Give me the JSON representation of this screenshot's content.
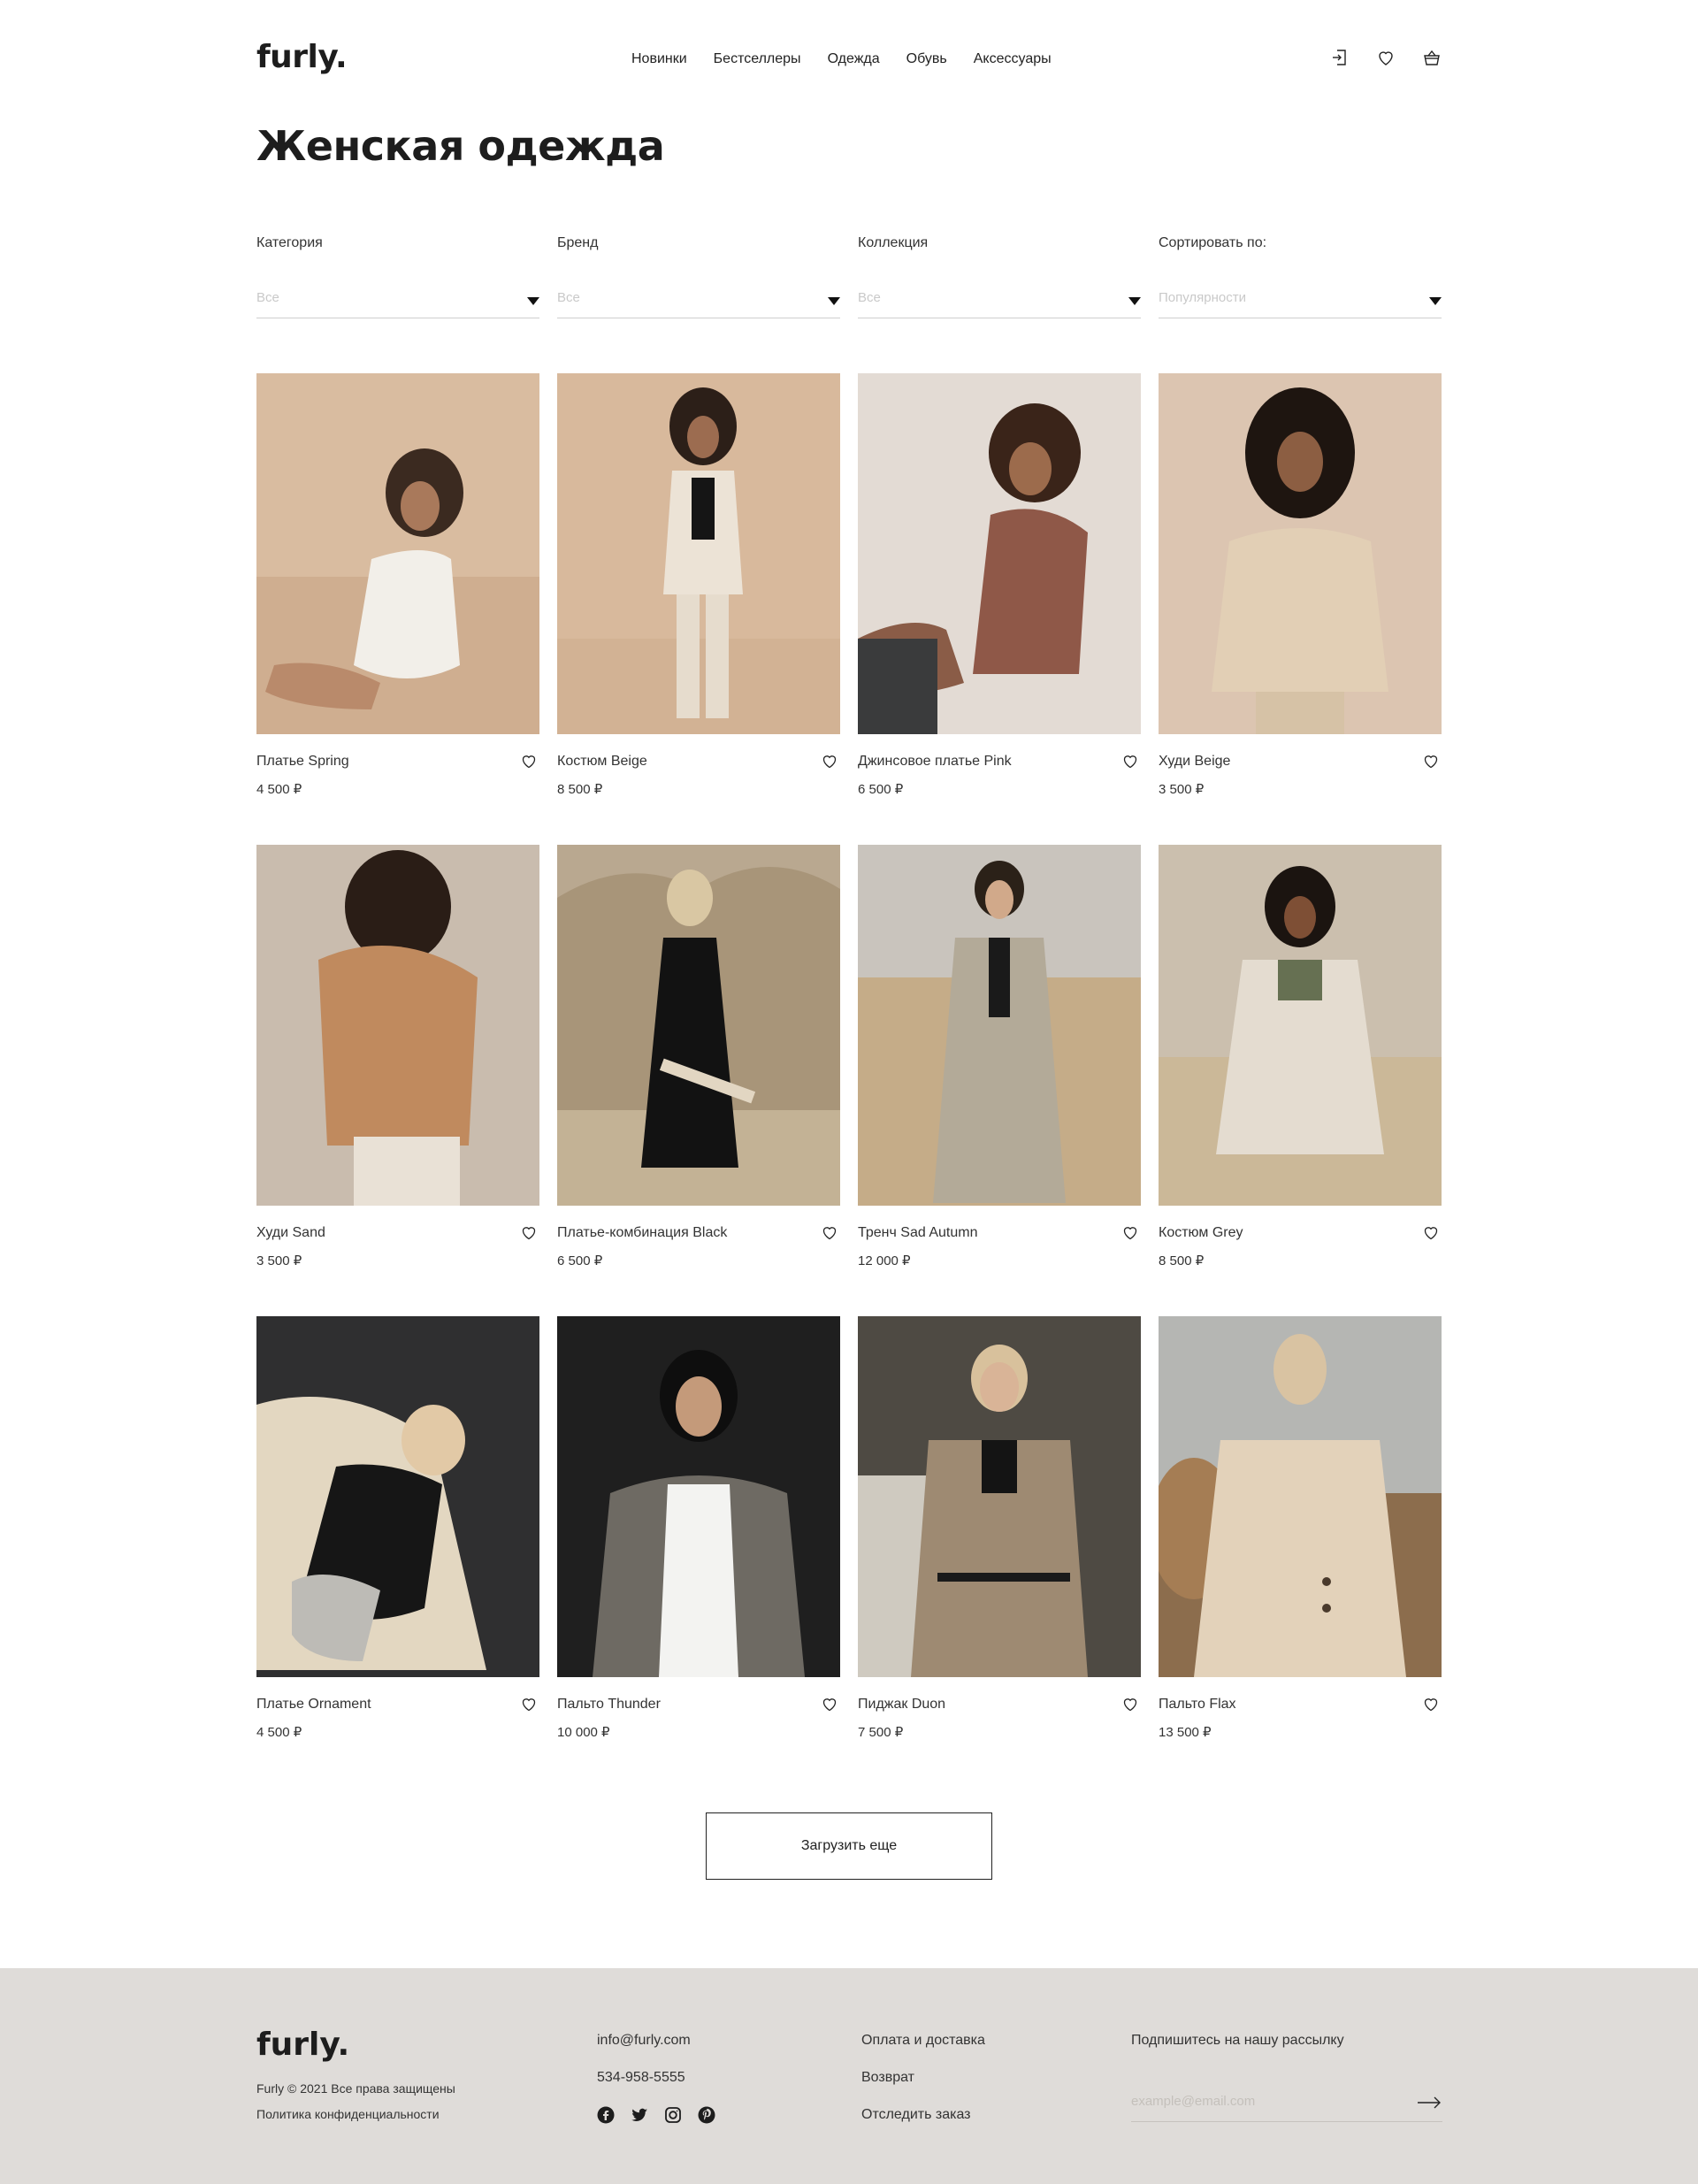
{
  "header": {
    "logo": "furly.",
    "nav": [
      "Новинки",
      "Бестселлеры",
      "Одежда",
      "Обувь",
      "Аксессуары"
    ],
    "icons": [
      "login-icon",
      "heart-icon",
      "basket-icon"
    ]
  },
  "page": {
    "title": "Женская одежда"
  },
  "filters": [
    {
      "label": "Категория",
      "value": "Все"
    },
    {
      "label": "Бренд",
      "value": "Все"
    },
    {
      "label": "Коллекция",
      "value": "Все"
    },
    {
      "label": "Сортировать по:",
      "value": "Популярности"
    }
  ],
  "products": [
    {
      "name": "Платье Spring",
      "price": "4 500 ₽"
    },
    {
      "name": "Костюм Beige",
      "price": "8 500 ₽"
    },
    {
      "name": "Джинсовое платье Pink",
      "price": "6 500 ₽"
    },
    {
      "name": "Худи Beige",
      "price": "3 500 ₽"
    },
    {
      "name": "Худи Sand",
      "price": "3 500 ₽"
    },
    {
      "name": "Платье-комбинация Black",
      "price": "6 500 ₽"
    },
    {
      "name": "Тренч Sad Autumn",
      "price": "12 000 ₽"
    },
    {
      "name": "Костюм Grey",
      "price": "8 500 ₽"
    },
    {
      "name": "Платье Ornament",
      "price": "4 500 ₽"
    },
    {
      "name": "Пальто Thunder",
      "price": "10 000 ₽"
    },
    {
      "name": "Пиджак Duon",
      "price": "7 500 ₽"
    },
    {
      "name": "Пальто Flax",
      "price": "13 500 ₽"
    }
  ],
  "load_more": "Загрузить еще",
  "footer": {
    "logo": "furly.",
    "copyright": "Furly © 2021 Все права защищены",
    "privacy": "Политика конфиденциальности",
    "email": "info@furly.com",
    "phone": "534-958-5555",
    "social": [
      "facebook-icon",
      "twitter-icon",
      "instagram-icon",
      "pinterest-icon"
    ],
    "links": [
      "Оплата и доставка",
      "Возврат",
      "Отследить заказ"
    ],
    "subscribe_title": "Подпишитесь на нашу рассылку",
    "subscribe_placeholder": "example@email.com"
  },
  "colors": {
    "footer_bg": "#dfdcd9",
    "text": "#222222",
    "accent": "#1d1d1d"
  }
}
